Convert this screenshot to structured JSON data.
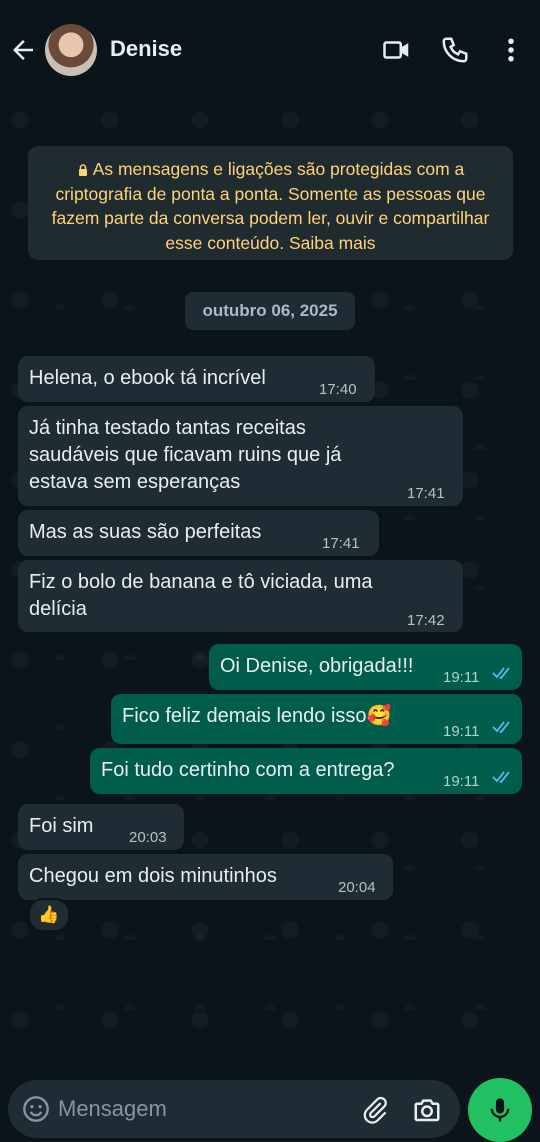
{
  "header": {
    "contact_name": "Denise",
    "icons": [
      "back-arrow-icon",
      "video-call-icon",
      "phone-icon",
      "more-options-icon"
    ]
  },
  "notice": {
    "text": "As mensagens e ligações são protegidas com a criptografia de ponta a ponta. Somente as pessoas que fazem parte da conversa podem ler, ouvir e compartilhar esse conteúdo. Saiba mais",
    "color": "#ffd279"
  },
  "date_separator": "outubro 06, 2025",
  "messages": [
    {
      "direction": "in",
      "lines": [
        "Helena, o ebook tá incrível"
      ],
      "time": "17:40"
    },
    {
      "direction": "in",
      "lines": [
        "Já tinha testado tantas receitas",
        "saudáveis que ficavam ruins que já",
        "estava sem esperanças"
      ],
      "time": "17:41"
    },
    {
      "direction": "in",
      "lines": [
        "Mas as suas são perfeitas"
      ],
      "time": "17:41"
    },
    {
      "direction": "in",
      "lines": [
        "Fiz o bolo de banana e tô viciada, uma",
        "delícia"
      ],
      "time": "17:42"
    },
    {
      "direction": "out",
      "lines": [
        "Oi Denise, obrigada!!!"
      ],
      "time": "19:11",
      "status": "read"
    },
    {
      "direction": "out",
      "lines": [
        "Fico feliz demais lendo isso🥰"
      ],
      "time": "19:11",
      "status": "read"
    },
    {
      "direction": "out",
      "lines": [
        "Foi tudo certinho com a entrega?"
      ],
      "time": "19:11",
      "status": "read"
    },
    {
      "direction": "in",
      "lines": [
        "Foi sim"
      ],
      "time": "20:03"
    },
    {
      "direction": "in",
      "lines": [
        "Chegou em dois minutinhos"
      ],
      "time": "20:04",
      "reaction": "👍"
    }
  ],
  "composer": {
    "placeholder": "Mensagem",
    "icons": [
      "emoji-icon",
      "attach-icon",
      "camera-icon",
      "mic-icon"
    ]
  },
  "colors": {
    "background": "#0b141a",
    "incoming_bubble": "#202c33",
    "outgoing_bubble": "#005c4b",
    "read_ticks": "#53bdeb",
    "send_button": "#21c063"
  }
}
